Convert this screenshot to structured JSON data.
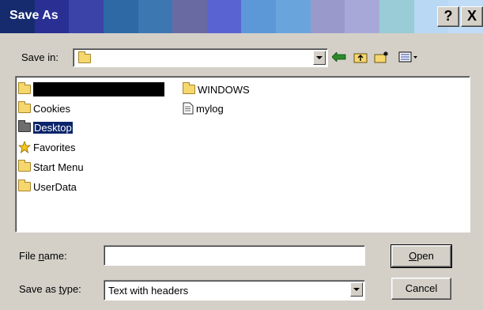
{
  "window": {
    "title": "Save As",
    "help_label": "?",
    "close_label": "X",
    "title_colors": [
      "#152b6e",
      "#2a2f94",
      "#3b43a8",
      "#2e69a6",
      "#3d77b2",
      "#6a6aa2",
      "#5a63d2",
      "#5c98d8",
      "#6aa4dc",
      "#9999cc",
      "#a8a8d8",
      "#99ccd6",
      "#b8d8f4",
      "#c0dcf6"
    ]
  },
  "toolbar": {
    "save_in_label": "Save in:",
    "save_in_value": "",
    "icons": [
      "back-arrow-icon",
      "up-folder-icon",
      "new-folder-icon",
      "view-menu-icon"
    ]
  },
  "files": {
    "left": [
      {
        "name": "",
        "redacted": true
      },
      {
        "name": "Cookies"
      },
      {
        "name": "Desktop",
        "selected": true
      },
      {
        "name": "Favorites",
        "icon": "star-folder-icon"
      },
      {
        "name": "Start Menu"
      },
      {
        "name": "UserData"
      }
    ],
    "right": [
      {
        "name": "WINDOWS",
        "icon": "folder-icon"
      },
      {
        "name": "mylog",
        "icon": "text-file-icon"
      }
    ]
  },
  "form": {
    "file_name_label_pre": "File ",
    "file_name_label_u": "n",
    "file_name_label_post": "ame:",
    "file_name_value": "",
    "save_type_label_pre": "Save as ",
    "save_type_label_u": "t",
    "save_type_label_post": "ype:",
    "save_type_value": "Text with headers"
  },
  "buttons": {
    "open_u": "O",
    "open_rest": "pen",
    "cancel": "Cancel"
  }
}
